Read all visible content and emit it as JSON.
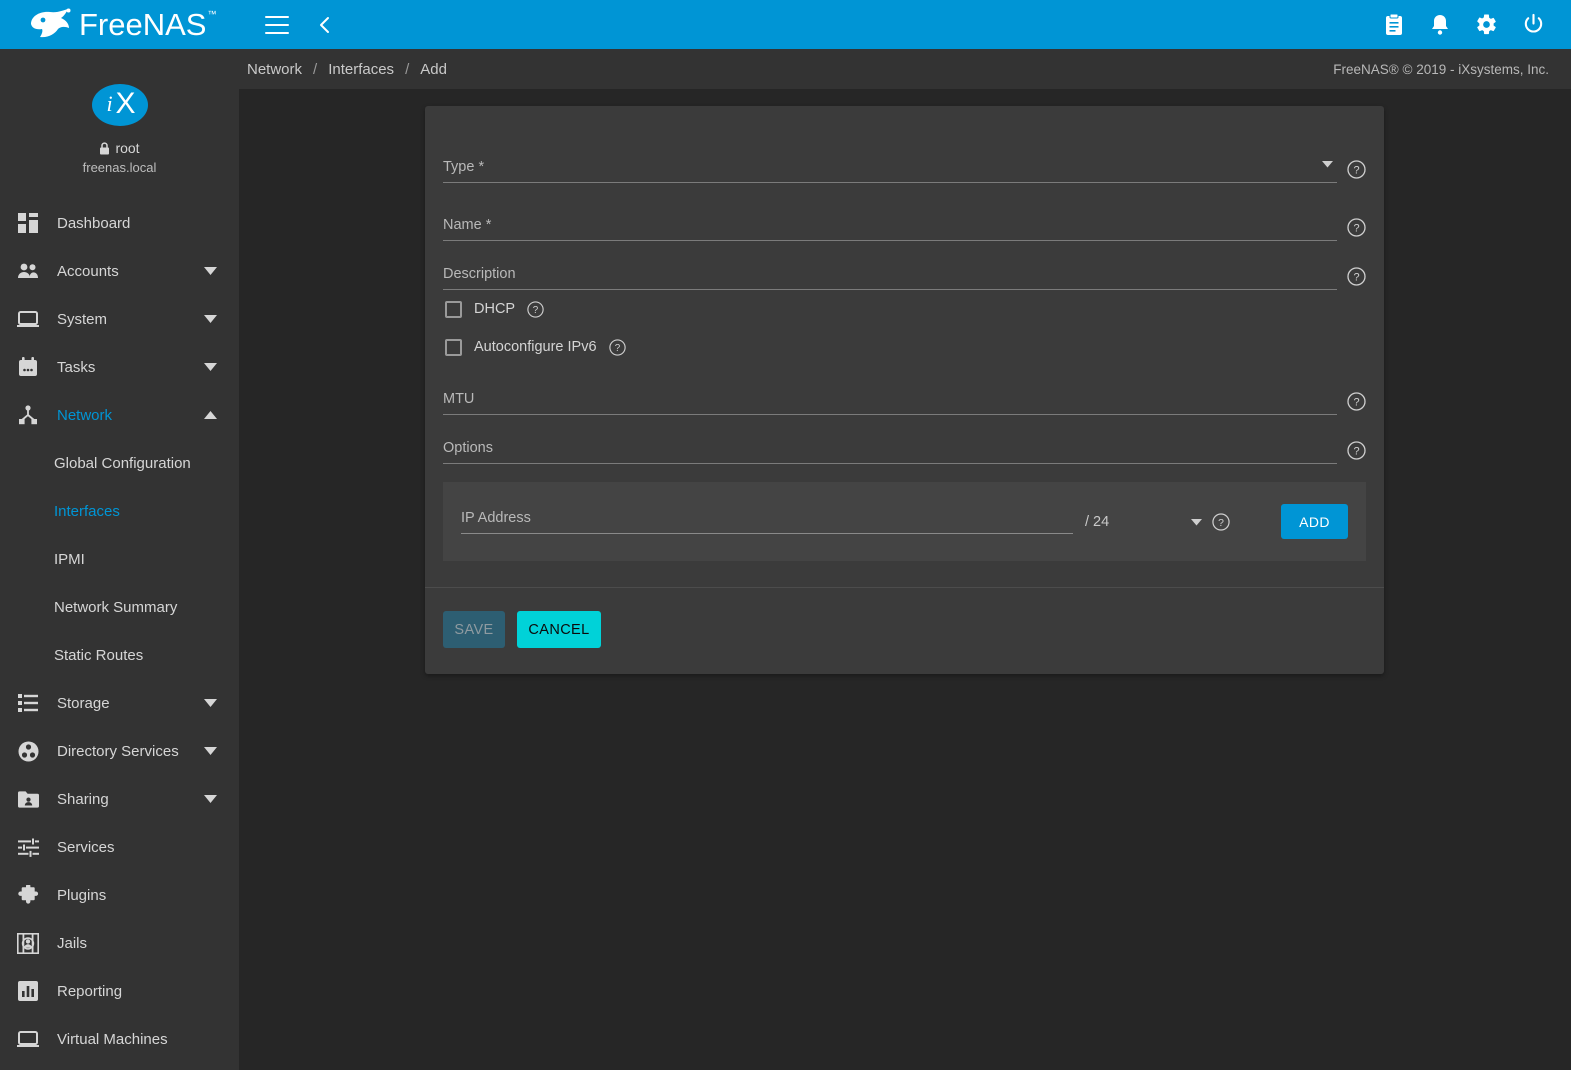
{
  "app": {
    "brand": "FreeNAS",
    "brand_tm": "™",
    "copyright": "FreeNAS® © 2019 - iXsystems, Inc."
  },
  "topbar": {
    "menu_icon": "hamburger-menu-icon",
    "back_icon": "chevron-left-icon",
    "icons": [
      {
        "name": "clipboard-icon",
        "label": "Task Manager"
      },
      {
        "name": "bell-icon",
        "label": "Alerts"
      },
      {
        "name": "gear-icon",
        "label": "Settings"
      },
      {
        "name": "power-icon",
        "label": "Power"
      }
    ]
  },
  "sidebar": {
    "logo_alt": "iX",
    "user": "root",
    "host": "freenas.local",
    "lock_icon": "lock-icon",
    "items": [
      {
        "label": "Dashboard",
        "icon": "dashboard-icon",
        "expandable": false,
        "active": false
      },
      {
        "label": "Accounts",
        "icon": "people-icon",
        "expandable": true,
        "active": false
      },
      {
        "label": "System",
        "icon": "laptop-icon",
        "expandable": true,
        "active": false
      },
      {
        "label": "Tasks",
        "icon": "calendar-icon",
        "expandable": true,
        "active": false
      },
      {
        "label": "Network",
        "icon": "network-icon",
        "expandable": true,
        "active": true,
        "expanded": true
      }
    ],
    "network_children": [
      {
        "label": "Global Configuration",
        "active": false
      },
      {
        "label": "Interfaces",
        "active": true
      },
      {
        "label": "IPMI",
        "active": false
      },
      {
        "label": "Network Summary",
        "active": false
      },
      {
        "label": "Static Routes",
        "active": false
      }
    ],
    "items_after": [
      {
        "label": "Storage",
        "icon": "storage-icon",
        "expandable": true,
        "active": false
      },
      {
        "label": "Directory Services",
        "icon": "directory-icon",
        "expandable": true,
        "active": false
      },
      {
        "label": "Sharing",
        "icon": "sharing-folder-icon",
        "expandable": true,
        "active": false
      },
      {
        "label": "Services",
        "icon": "sliders-icon",
        "expandable": false,
        "active": false
      },
      {
        "label": "Plugins",
        "icon": "puzzle-icon",
        "expandable": false,
        "active": false
      },
      {
        "label": "Jails",
        "icon": "jail-icon",
        "expandable": false,
        "active": false
      },
      {
        "label": "Reporting",
        "icon": "bar-chart-icon",
        "expandable": false,
        "active": false
      },
      {
        "label": "Virtual Machines",
        "icon": "monitor-icon",
        "expandable": false,
        "active": false
      }
    ]
  },
  "breadcrumb": {
    "items": [
      "Network",
      "Interfaces",
      "Add"
    ],
    "separator": "/"
  },
  "form": {
    "fields": [
      {
        "label": "Type *",
        "value": "",
        "type": "select",
        "help": true
      },
      {
        "label": "Name *",
        "value": "",
        "type": "text",
        "help": true
      },
      {
        "label": "Description",
        "value": "",
        "type": "text",
        "help": true
      }
    ],
    "checkboxes": [
      {
        "label": "DHCP",
        "checked": false,
        "help": true
      },
      {
        "label": "Autoconfigure IPv6",
        "checked": false,
        "help": true
      }
    ],
    "fields_after": [
      {
        "label": "MTU",
        "value": "",
        "type": "text",
        "help": true
      },
      {
        "label": "Options",
        "value": "",
        "type": "text",
        "help": true
      }
    ],
    "ip_row": {
      "address_label": "IP Address",
      "address_value": "",
      "netmask": "/ 24",
      "add_label": "ADD",
      "help": true
    },
    "actions": {
      "save_label": "SAVE",
      "save_disabled": true,
      "cancel_label": "CANCEL"
    }
  },
  "colors": {
    "accent": "#0095d5",
    "cancel": "#00d2d8",
    "save_disabled_bg": "#2d5e72",
    "sidebar_bg": "#333333",
    "content_bg": "#262626",
    "card_bg": "#3b3b3b",
    "panel_bg": "#444444"
  }
}
